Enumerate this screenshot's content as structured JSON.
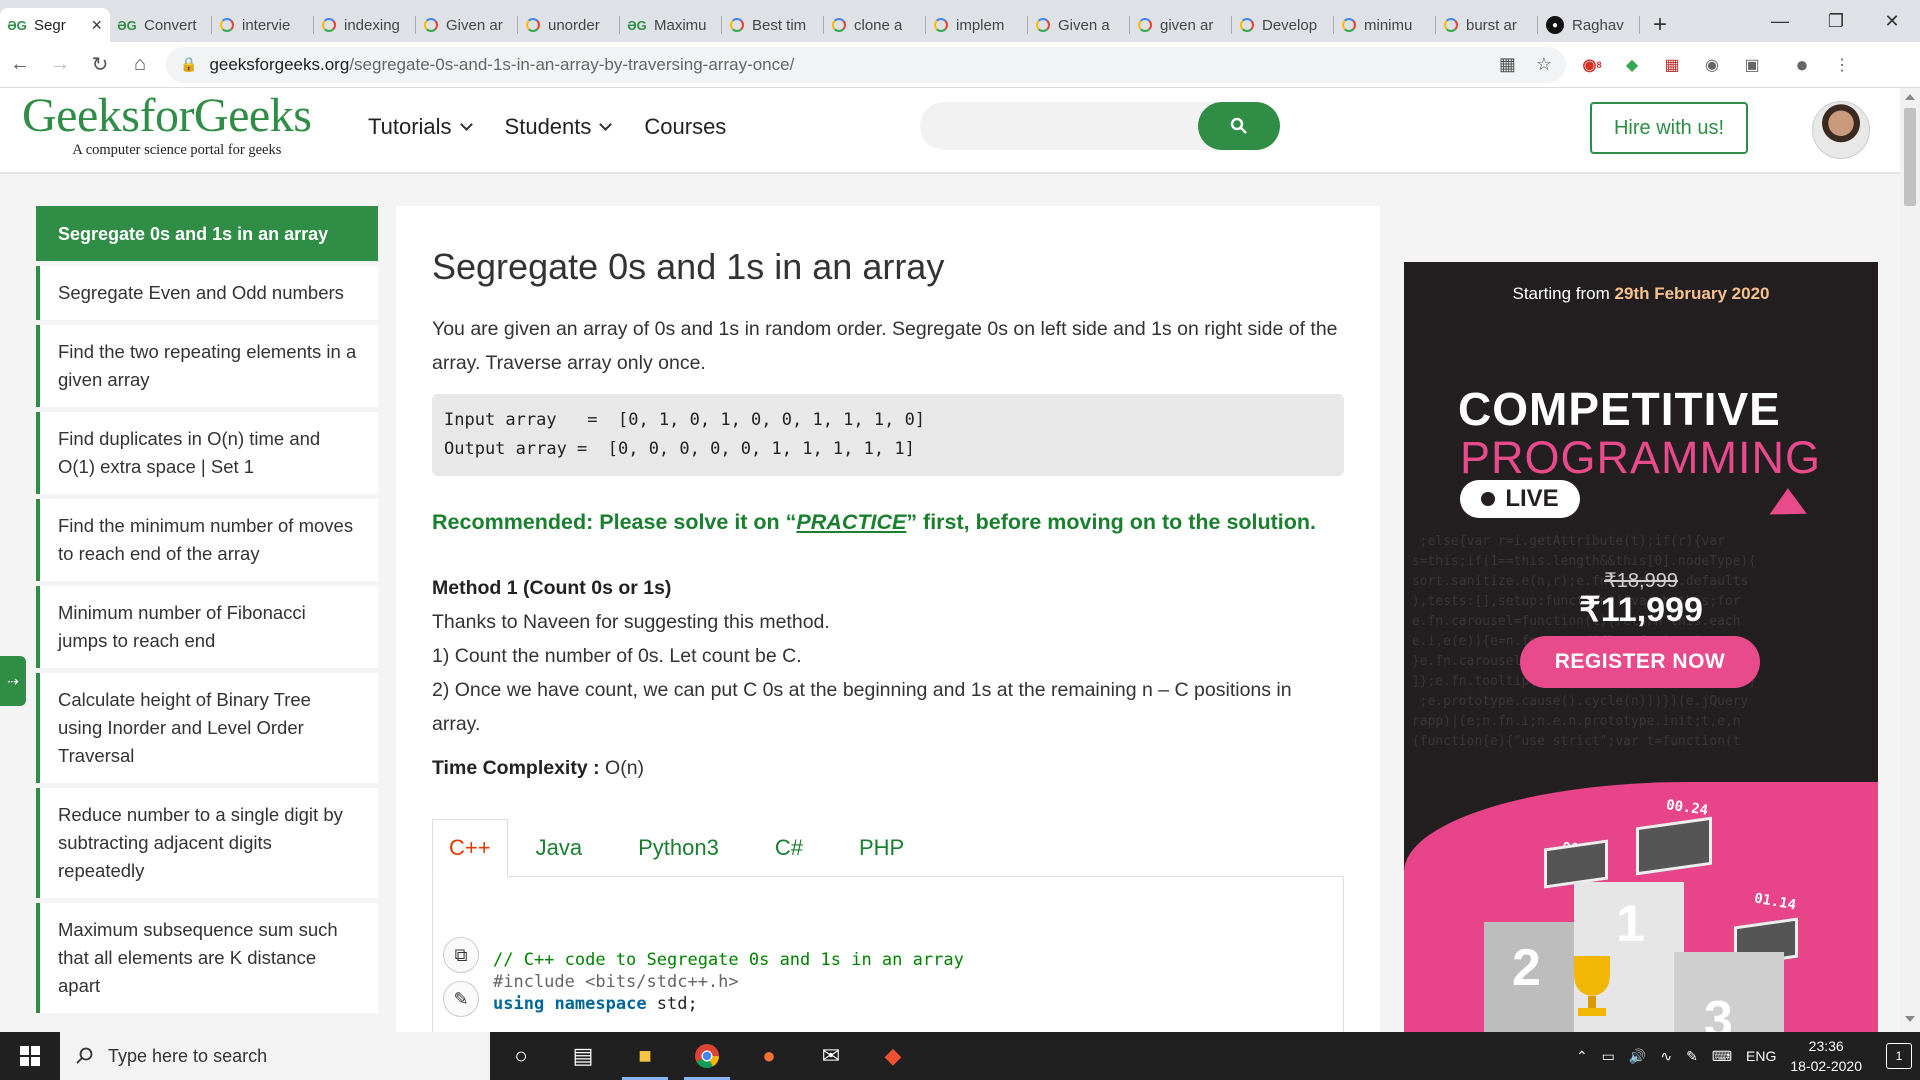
{
  "browser": {
    "tabs": [
      {
        "icon": "gfg-icon",
        "title": "Segr",
        "active": true
      },
      {
        "icon": "gfg-icon",
        "title": "Convert"
      },
      {
        "icon": "google-icon",
        "title": "intervie"
      },
      {
        "icon": "google-icon",
        "title": "indexing"
      },
      {
        "icon": "google-icon",
        "title": "Given ar"
      },
      {
        "icon": "google-icon",
        "title": "unorder"
      },
      {
        "icon": "gfg-icon",
        "title": "Maximu"
      },
      {
        "icon": "google-icon",
        "title": "Best tim"
      },
      {
        "icon": "google-icon",
        "title": "clone a"
      },
      {
        "icon": "google-icon",
        "title": "implem"
      },
      {
        "icon": "google-icon",
        "title": "Given a"
      },
      {
        "icon": "google-icon",
        "title": "given ar"
      },
      {
        "icon": "google-icon",
        "title": "Develop"
      },
      {
        "icon": "google-icon",
        "title": "minimu"
      },
      {
        "icon": "google-icon",
        "title": "burst ar"
      },
      {
        "icon": "github-icon",
        "title": "Raghav"
      }
    ],
    "url_host": "geeksforgeeks.org",
    "url_path": "/segregate-0s-and-1s-in-an-array-by-traversing-array-once/",
    "ext_badge": "8"
  },
  "header": {
    "logo": "GeeksforGeeks",
    "tagline": "A computer science portal for geeks",
    "nav": [
      "Tutorials",
      "Students",
      "Courses"
    ],
    "hire_label": "Hire with us!"
  },
  "sidebar": {
    "items": [
      "Segregate 0s and 1s in an array",
      "Segregate Even and Odd numbers",
      "Find the two repeating elements in a given array",
      "Find duplicates in O(n) time and O(1) extra space | Set 1",
      "Find the minimum number of moves to reach end of the array",
      "Minimum number of Fibonacci jumps to reach end",
      "Calculate height of Binary Tree using Inorder and Level Order Traversal",
      "Reduce number to a single digit by subtracting adjacent digits repeatedly",
      "Maximum subsequence sum such that all elements are K distance apart"
    ]
  },
  "article": {
    "title": "Segregate 0s and 1s in an array",
    "intro": "You are given an array of 0s and 1s in random order. Segregate 0s on left side and 1s on right side of the array. Traverse array only once.",
    "example_input": "Input array   =  [0, 1, 0, 1, 0, 0, 1, 1, 1, 0]",
    "example_output": "Output array =  [0, 0, 0, 0, 0, 1, 1, 1, 1, 1]",
    "recommend_pre": "Recommended: Please solve it on “",
    "recommend_link": "PRACTICE",
    "recommend_post": "” first, before moving on to the solution.",
    "method_title": "Method 1 (Count 0s or 1s)",
    "method_lines": [
      "Thanks to Naveen for suggesting this method.",
      "1) Count the number of 0s. Let count be C.",
      "2) Once we have count, we can put C 0s at the beginning and 1s at the remaining n – C positions in array."
    ],
    "tc_label": "Time Complexity :",
    "tc_value": " O(n)",
    "code_tabs": [
      "C++",
      "Java",
      "Python3",
      "C#",
      "PHP"
    ],
    "code": {
      "comment": "// C++ code to Segregate 0s and 1s in an array",
      "include": "#include <bits/stdc++.h>",
      "kw1": "using",
      "kw2": "namespace",
      "rest": " std;"
    }
  },
  "ad": {
    "starting": "Starting from ",
    "date": "29th February 2020",
    "title1": "COMPETITIVE",
    "title2": "PROGRAMMING",
    "live": "LIVE",
    "old_price": "₹18,999",
    "new_price": "₹11,999",
    "cta": "REGISTER NOW",
    "timers": [
      "00.24",
      "00.60",
      "01.14"
    ],
    "ranks": [
      "2",
      "1",
      "3"
    ]
  },
  "taskbar": {
    "search_placeholder": "Type here to search",
    "lang": "ENG",
    "time": "23:36",
    "date": "18-02-2020",
    "notif_count": "1"
  }
}
